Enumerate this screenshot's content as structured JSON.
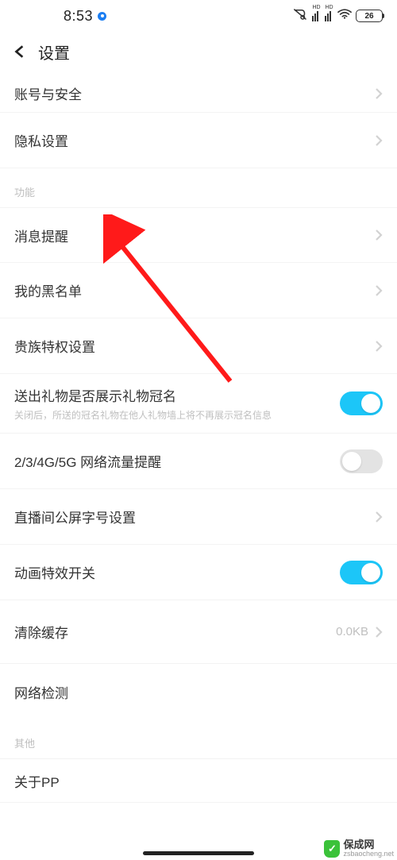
{
  "status": {
    "time": "8:53",
    "sig_label": "HD",
    "battery": "26"
  },
  "header": {
    "title": "设置"
  },
  "rows": {
    "r0": {
      "label": "账号与安全"
    },
    "r1": {
      "label": "隐私设置"
    },
    "sec_func": "功能",
    "r2": {
      "label": "消息提醒"
    },
    "r3": {
      "label": "我的黑名单"
    },
    "r4": {
      "label": "贵族特权设置"
    },
    "r5": {
      "label": "送出礼物是否展示礼物冠名",
      "sub": "关闭后，所送的冠名礼物在他人礼物墙上将不再展示冠名信息",
      "on": true
    },
    "r6": {
      "label": "2/3/4G/5G 网络流量提醒",
      "on": false
    },
    "r7": {
      "label": "直播间公屏字号设置"
    },
    "r8": {
      "label": "动画特效开关",
      "on": true
    },
    "r9": {
      "label": "清除缓存",
      "value": "0.0KB"
    },
    "r10": {
      "label": "网络检测"
    },
    "sec_other": "其他",
    "r11": {
      "label": "关于PP"
    }
  },
  "watermark": {
    "brand": "保成网",
    "url": "zsbaocheng.net"
  }
}
